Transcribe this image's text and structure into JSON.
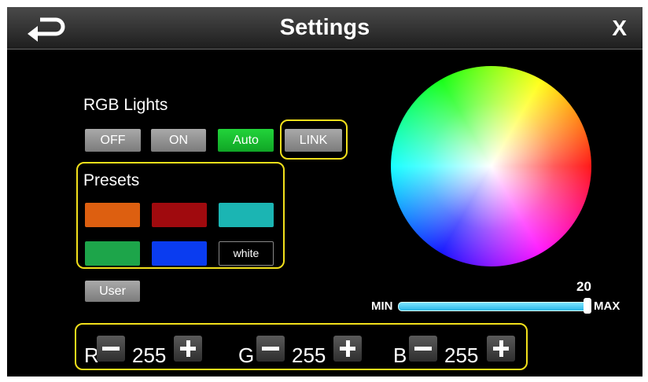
{
  "header": {
    "title": "Settings",
    "back_icon": "return-arrow-icon",
    "close_label": "X"
  },
  "rgb_lights": {
    "label": "RGB Lights",
    "buttons": [
      {
        "label": "OFF",
        "active": false
      },
      {
        "label": "ON",
        "active": false
      },
      {
        "label": "Auto",
        "active": true
      },
      {
        "label": "LINK",
        "active": false
      }
    ]
  },
  "presets": {
    "label": "Presets",
    "colors": [
      "#dd5f10",
      "#a00a0e",
      "#1bb5b3",
      "#1da54a",
      "#0a3cf0",
      "#000000"
    ],
    "white_label": "white"
  },
  "user_button": {
    "label": "User"
  },
  "brightness": {
    "value": "20",
    "min_label": "MIN",
    "max_label": "MAX",
    "fraction": 1.0
  },
  "rgb": {
    "r_label": "R",
    "r_value": "255",
    "g_label": "G",
    "g_value": "255",
    "b_label": "B",
    "b_value": "255"
  },
  "colors": {
    "highlight": "#f2e01b",
    "active_button": "#18c030",
    "slider": "#3cc8f0"
  }
}
